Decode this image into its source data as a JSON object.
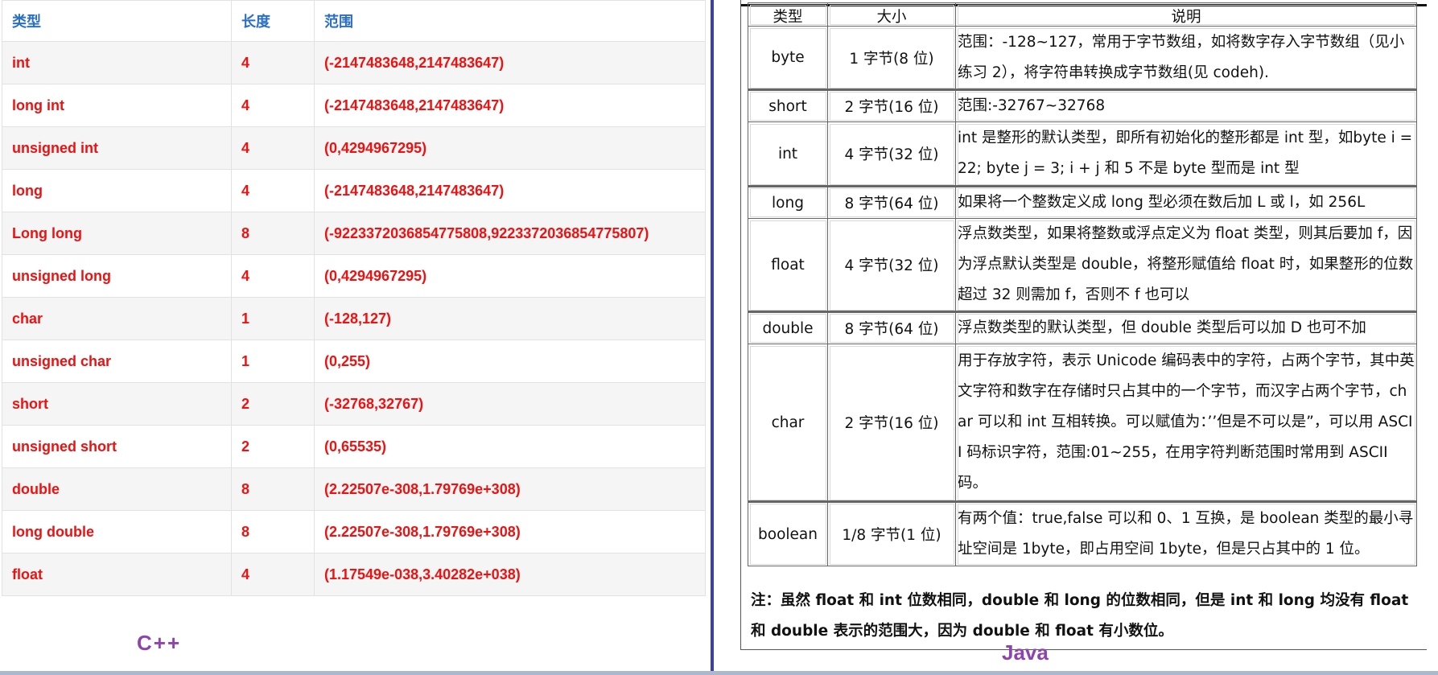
{
  "cpp": {
    "label": "C++",
    "headers": [
      "类型",
      "长度",
      "范围"
    ],
    "rows": [
      {
        "type": "int",
        "length": "4",
        "range": "(-2147483648,2147483647)"
      },
      {
        "type": "long int",
        "length": "4",
        "range": "(-2147483648,2147483647)"
      },
      {
        "type": "unsigned int",
        "length": "4",
        "range": "(0,4294967295)"
      },
      {
        "type": "long",
        "length": "4",
        "range": "(-2147483648,2147483647)"
      },
      {
        "type": "Long long",
        "length": "8",
        "range": "(-9223372036854775808,9223372036854775807)"
      },
      {
        "type": "unsigned long",
        "length": "4",
        "range": "(0,4294967295)"
      },
      {
        "type": "char",
        "length": "1",
        "range": "(-128,127)"
      },
      {
        "type": "unsigned char",
        "length": "1",
        "range": "(0,255)"
      },
      {
        "type": "short",
        "length": "2",
        "range": "(-32768,32767)"
      },
      {
        "type": "unsigned short",
        "length": "2",
        "range": "(0,65535)"
      },
      {
        "type": "double",
        "length": "8",
        "range": "(2.22507e-308,1.79769e+308)"
      },
      {
        "type": "long double",
        "length": "8",
        "range": "(2.22507e-308,1.79769e+308)"
      },
      {
        "type": "float",
        "length": "4",
        "range": "(1.17549e-038,3.40282e+038)"
      }
    ]
  },
  "java": {
    "label": "Java",
    "headers": [
      "类型",
      "大小",
      "说明"
    ],
    "rows": [
      {
        "type": "byte",
        "size": "1 字节(8 位)",
        "desc": "范围：-128~127，常用于字节数组，如将数字存入字节数组（见小练习 2），将字符串转换成字节数组(见 codeh)."
      },
      {
        "type": "short",
        "size": "2 字节(16 位)",
        "desc": "范围:-32767~32768"
      },
      {
        "type": "int",
        "size": "4 字节(32 位)",
        "desc": "int 是整形的默认类型，即所有初始化的整形都是 int 型，如byte i = 22; byte j = 3; i + j  和 5 不是 byte 型而是 int 型"
      },
      {
        "type": "long",
        "size": "8 字节(64 位)",
        "desc": "如果将一个整数定义成 long 型必须在数后加 L 或 l，如 256L"
      },
      {
        "type": "float",
        "size": "4 字节(32 位)",
        "desc": "浮点数类型，如果将整数或浮点定义为 float 类型，则其后要加 f，因为浮点默认类型是 double，将整形赋值给 float 时，如果整形的位数超过 32 则需加 f，否则不 f 也可以"
      },
      {
        "type": "double",
        "size": "8 字节(64 位)",
        "desc": "浮点数类型的默认类型，但 double 类型后可以加 D 也可不加"
      },
      {
        "type": "char",
        "size": "2 字节(16 位)",
        "desc": "用于存放字符，表示 Unicode 编码表中的字符，占两个字节，其中英文字符和数字在存储时只占其中的一个字节，而汉字占两个字节，char 可以和 int 互相转换。可以赋值为：’’但是不可以是”，可以用 ASCII 码标识字符，范围:01~255，在用字符判断范围时常用到 ASCII 码。"
      },
      {
        "type": "boolean",
        "size": "1/8 字节(1 位)",
        "desc": "有两个值：true,false  可以和 0、1 互换，是 boolean 类型的最小寻址空间是 1byte，即占用空间 1byte，但是只占其中的 1 位。"
      }
    ],
    "note": "注：虽然 float 和 int 位数相同，double 和 long 的位数相同，但是 int 和 long 均没有 float 和 double 表示的范围大，因为 double 和 float 有小数位。"
  }
}
